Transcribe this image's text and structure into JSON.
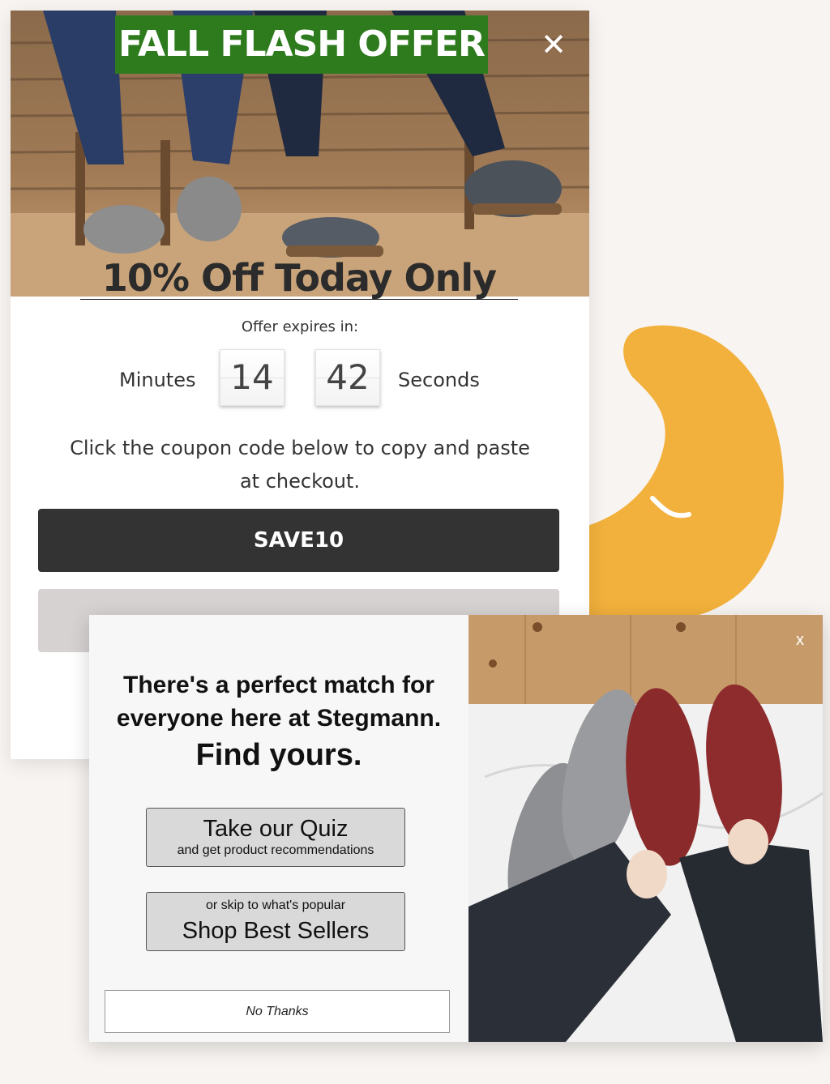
{
  "flash_popup": {
    "title": "FALL FLASH OFFER",
    "close_symbol": "✕",
    "headline": "10% Off Today Only",
    "expires_label": "Offer expires in:",
    "timer": {
      "minutes_label": "Minutes",
      "minutes": "14",
      "seconds": "42",
      "seconds_label": "Seconds"
    },
    "instructions": "Click the coupon code below to copy and paste at checkout.",
    "coupon_code": "SAVE10",
    "hero_image_icon": "felt-clogs-photo-icon",
    "title_bg_color": "#2e7b1e",
    "coupon_bg_color": "#333333"
  },
  "quiz_popup": {
    "headline": "There's a perfect match for everyone here at Stegmann.",
    "subheadline": "Find yours.",
    "quiz_button": {
      "title": "Take our Quiz",
      "subtitle": "and get product recommendations"
    },
    "bestsellers_button": {
      "subtitle": "or skip to what's popular",
      "title": "Shop Best Sellers"
    },
    "no_thanks": "No Thanks",
    "close_symbol": "x",
    "photo_icon": "slippers-on-bed-photo-icon"
  },
  "decoration": {
    "blob_color": "#f2b13c"
  }
}
